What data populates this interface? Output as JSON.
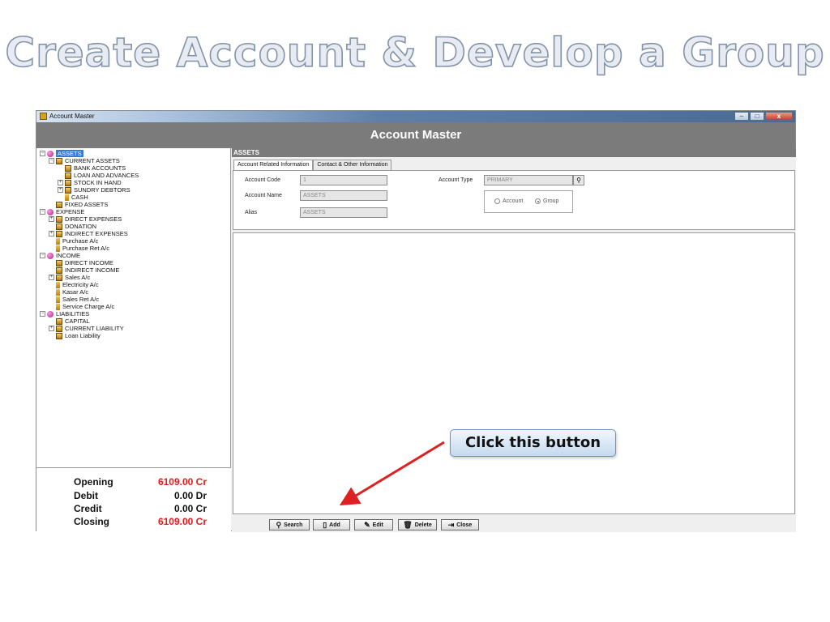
{
  "slide": {
    "title": "Create  Account & Develop a Group"
  },
  "window": {
    "title": "Account Master",
    "controls": {
      "minimize": "–",
      "maximize": "□",
      "close": "x"
    }
  },
  "header": {
    "title": "Account Master"
  },
  "tree": {
    "items": [
      {
        "label": "ASSETS",
        "level": 0,
        "expander": "−",
        "icon": "root-group-icon",
        "selected": true
      },
      {
        "label": "CURRENT ASSETS",
        "level": 1,
        "expander": "−",
        "icon": "group-icon"
      },
      {
        "label": "BANK ACCOUNTS",
        "level": 2,
        "expander": "",
        "icon": "group-icon"
      },
      {
        "label": "LOAN AND ADVANCES",
        "level": 2,
        "expander": "",
        "icon": "group-icon"
      },
      {
        "label": "STOCK IN HAND",
        "level": 2,
        "expander": "+",
        "icon": "group-icon"
      },
      {
        "label": "SUNDRY DEBTORS",
        "level": 2,
        "expander": "+",
        "icon": "group-icon"
      },
      {
        "label": "CASH",
        "level": 2,
        "expander": "",
        "icon": "ledger-icon"
      },
      {
        "label": "FIXED ASSETS",
        "level": 1,
        "expander": "",
        "icon": "group-icon"
      },
      {
        "label": "EXPENSE",
        "level": 0,
        "expander": "−",
        "icon": "root-group-icon"
      },
      {
        "label": "DIRECT EXPENSES",
        "level": 1,
        "expander": "+",
        "icon": "group-icon"
      },
      {
        "label": "DONATION",
        "level": 1,
        "expander": "",
        "icon": "group-icon"
      },
      {
        "label": "INDIRECT EXPENSES",
        "level": 1,
        "expander": "+",
        "icon": "group-icon"
      },
      {
        "label": "Purchase A/c",
        "level": 1,
        "expander": "",
        "icon": "ledger-icon"
      },
      {
        "label": "Purchase Ret A/c",
        "level": 1,
        "expander": "",
        "icon": "ledger-icon"
      },
      {
        "label": "INCOME",
        "level": 0,
        "expander": "−",
        "icon": "root-group-icon"
      },
      {
        "label": "DIRECT INCOME",
        "level": 1,
        "expander": "",
        "icon": "group-icon"
      },
      {
        "label": "INDIRECT INCOME",
        "level": 1,
        "expander": "",
        "icon": "group-icon"
      },
      {
        "label": "Sales A/c",
        "level": 1,
        "expander": "+",
        "icon": "group-icon"
      },
      {
        "label": "Electricity A/c",
        "level": 1,
        "expander": "",
        "icon": "ledger-icon"
      },
      {
        "label": "Kasar A/c",
        "level": 1,
        "expander": "",
        "icon": "ledger-icon"
      },
      {
        "label": "Sales Ret A/c",
        "level": 1,
        "expander": "",
        "icon": "ledger-icon"
      },
      {
        "label": "Service Charge A/c",
        "level": 1,
        "expander": "",
        "icon": "ledger-icon"
      },
      {
        "label": "LIABILITIES",
        "level": 0,
        "expander": "−",
        "icon": "root-group-icon"
      },
      {
        "label": "CAPITAL",
        "level": 1,
        "expander": "",
        "icon": "group-icon"
      },
      {
        "label": "CURRENT LIABILITY",
        "level": 1,
        "expander": "+",
        "icon": "group-icon"
      },
      {
        "label": "Loan Liability",
        "level": 1,
        "expander": "",
        "icon": "group-icon"
      }
    ]
  },
  "balances": [
    {
      "label": "Opening",
      "value": "6109.00 Cr",
      "color": "#e21a1a"
    },
    {
      "label": "Debit",
      "value": "0.00 Dr",
      "color": "#111111"
    },
    {
      "label": "Credit",
      "value": "0.00 Cr",
      "color": "#111111"
    },
    {
      "label": "Closing",
      "value": "6109.00 Cr",
      "color": "#e21a1a"
    }
  ],
  "section": {
    "title": "ASSETS"
  },
  "tabs": [
    {
      "label": "Account Related Information",
      "active": true
    },
    {
      "label": "Contact & Other Information",
      "active": false
    }
  ],
  "form": {
    "account_code": {
      "label": "Account Code",
      "value": "1"
    },
    "account_name": {
      "label": "Account Name",
      "value": "ASSETS"
    },
    "alias": {
      "label": "Alias",
      "value": "ASSETS"
    },
    "account_type": {
      "label": "Account Type",
      "value": "PRIMARY",
      "lookup_icon": "binoculars-icon"
    },
    "type_radio": {
      "options": [
        {
          "label": "Account",
          "checked": false
        },
        {
          "label": "Group",
          "checked": true
        }
      ]
    }
  },
  "toolbar": {
    "search_label": "Search",
    "add_label": "Add",
    "edit_label": "Edit",
    "delete_label": "Delete",
    "close_label": "Close"
  },
  "callout": {
    "text": "Click this button",
    "arrow_color": "#e02020"
  },
  "colors": {
    "header_band": "#7b7b7b",
    "selection": "#3a78d6",
    "balance_red": "#e21a1a",
    "callout_border": "#6f93bd"
  }
}
